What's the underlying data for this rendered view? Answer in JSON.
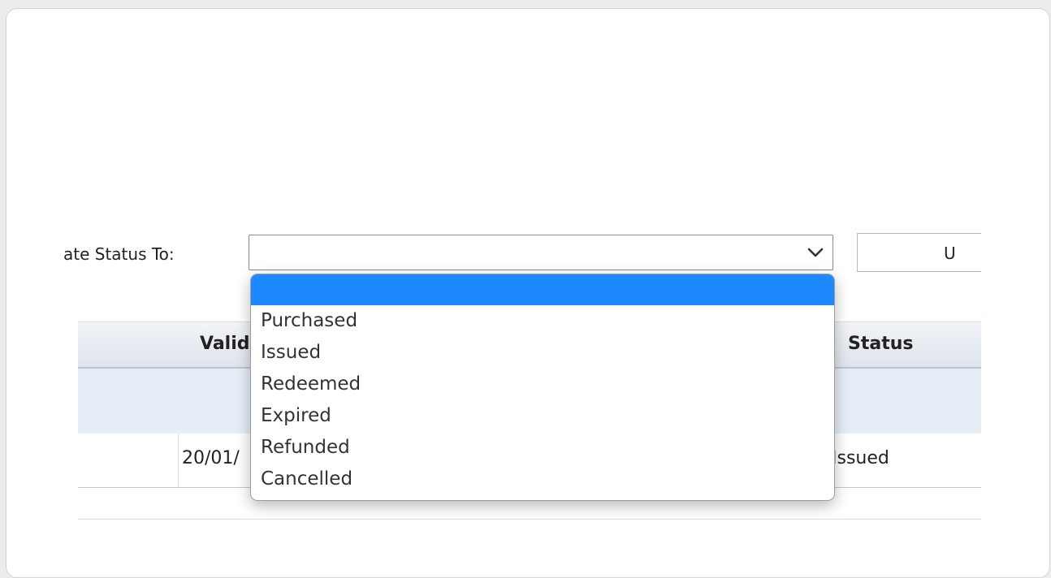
{
  "form": {
    "status_label": "ate Status To:",
    "select_value": "",
    "update_button_label": "U"
  },
  "dropdown": {
    "options": [
      "",
      "Purchased",
      "Issued",
      "Redeemed",
      "Expired",
      "Refunded",
      "Cancelled"
    ],
    "selected_index": 0
  },
  "table": {
    "headers": {
      "valid": "Valid",
      "status": "Status"
    },
    "rows": [
      {
        "valid": "20/01/",
        "status": "Issued"
      }
    ]
  },
  "colors": {
    "selected_option": "#1e88ff",
    "header_border": "#b9c4d0",
    "filter_row": "#e6edf6"
  }
}
